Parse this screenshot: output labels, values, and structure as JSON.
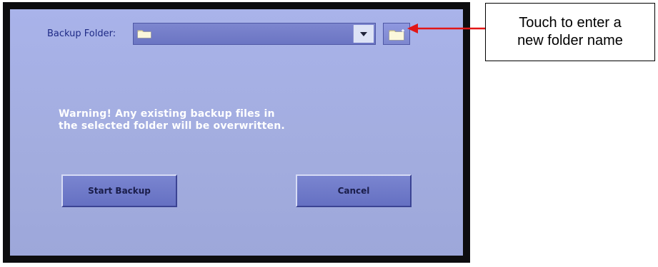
{
  "backup_screen": {
    "folder_label": "Backup Folder:",
    "folder_value": "",
    "folder_icon": "folder-icon",
    "dropdown_icon": "chevron-down-icon",
    "new_folder_icon": "new-folder-icon",
    "warning_line_1": "Warning!  Any existing backup files in",
    "warning_line_2": "the selected folder will be overwritten.",
    "start_label": "Start Backup",
    "cancel_label": "Cancel"
  },
  "callout": {
    "text": "Touch to enter a\nnew folder name",
    "arrow_color": "#e21616"
  },
  "colors": {
    "screen_bg": "#a6b0e4",
    "button_bg": "#6f7ac8",
    "label_text": "#1e2a86",
    "warning_text": "#ffffff"
  }
}
